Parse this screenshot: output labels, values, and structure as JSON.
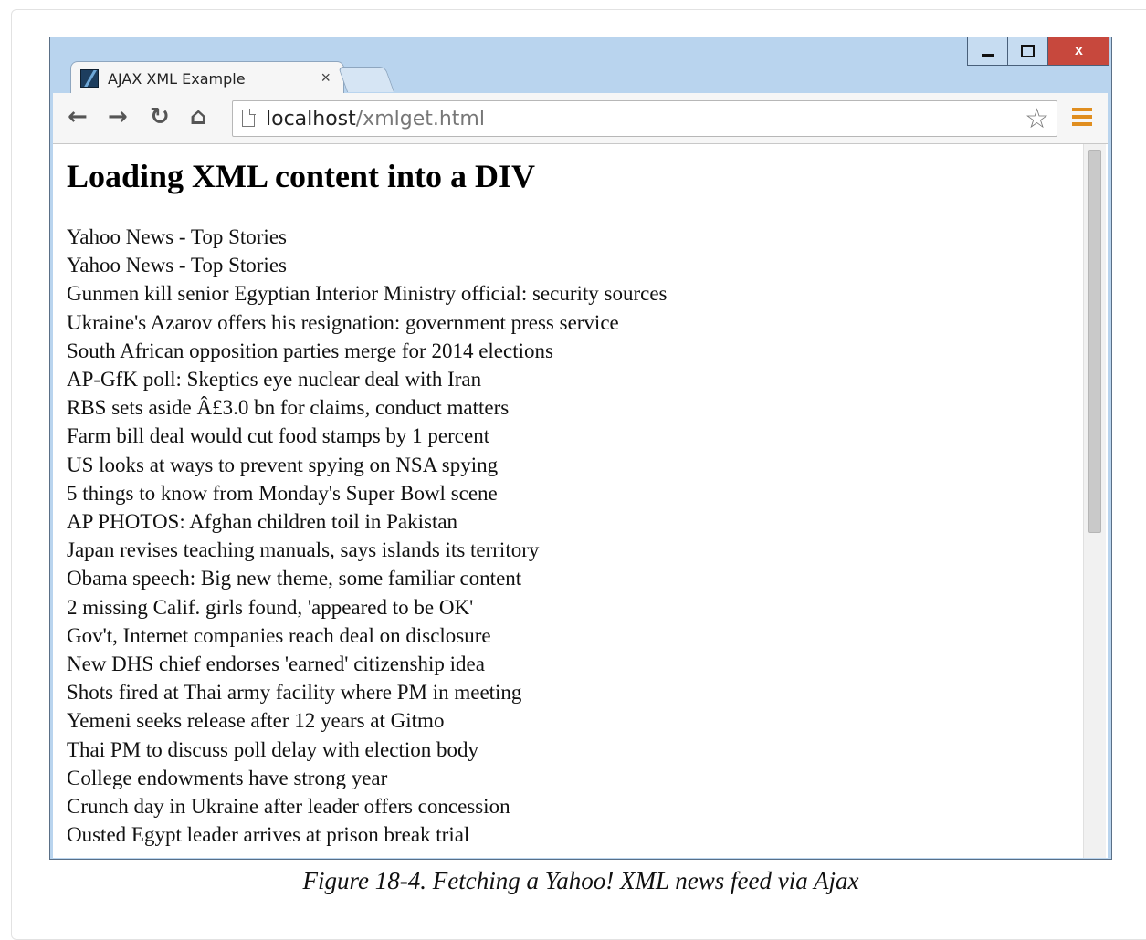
{
  "browser": {
    "tab_title": "AJAX XML Example",
    "tab_close": "×",
    "url_host": "localhost",
    "url_path": "/xmlget.html",
    "close_glyph": "x"
  },
  "page": {
    "heading": "Loading XML content into a DIV",
    "headlines": [
      "Yahoo News - Top Stories",
      "Yahoo News - Top Stories",
      "Gunmen kill senior Egyptian Interior Ministry official: security sources",
      "Ukraine's Azarov offers his resignation: government press service",
      "South African opposition parties merge for 2014 elections",
      "AP-GfK poll: Skeptics eye nuclear deal with Iran",
      "RBS sets aside Â£3.0 bn for claims, conduct matters",
      "Farm bill deal would cut food stamps by 1 percent",
      "US looks at ways to prevent spying on NSA spying",
      "5 things to know from Monday's Super Bowl scene",
      "AP PHOTOS: Afghan children toil in Pakistan",
      "Japan revises teaching manuals, says islands its territory",
      "Obama speech: Big new theme, some familiar content",
      "2 missing Calif. girls found, 'appeared to be OK'",
      "Gov't, Internet companies reach deal on disclosure",
      "New DHS chief endorses 'earned' citizenship idea",
      "Shots fired at Thai army facility where PM in meeting",
      "Yemeni seeks release after 12 years at Gitmo",
      "Thai PM to discuss poll delay with election body",
      "College endowments have strong year",
      "Crunch day in Ukraine after leader offers concession",
      "Ousted Egypt leader arrives at prison break trial"
    ]
  },
  "caption": "Figure 18-4. Fetching a Yahoo! XML news feed via Ajax"
}
